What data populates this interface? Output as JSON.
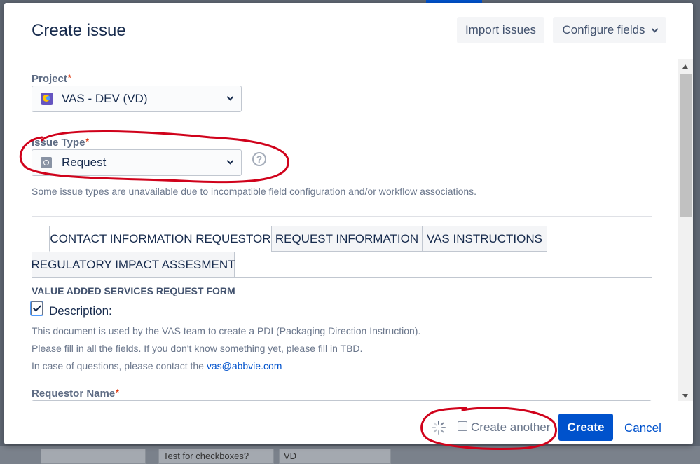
{
  "background": {
    "cells": [
      "",
      "Test for checkboxes?",
      "VD"
    ]
  },
  "dialog": {
    "title": "Create issue",
    "import_label": "Import issues",
    "configure_label": "Configure fields"
  },
  "form": {
    "project": {
      "label": "Project",
      "required_mark": "*",
      "value": "VAS - DEV (VD)"
    },
    "issue_type": {
      "label": "Issue Type",
      "required_mark": "*",
      "value": "Request",
      "help_glyph": "?"
    },
    "issue_type_note": "Some issue types are unavailable due to incompatible field configuration and/or workflow associations.",
    "tabs": [
      {
        "label": "CONTACT INFORMATION REQUESTOR",
        "active": true
      },
      {
        "label": "REQUEST INFORMATION",
        "active": false
      },
      {
        "label": "VAS INSTRUCTIONS",
        "active": false
      },
      {
        "label": "REGULATORY IMPACT ASSESMENT",
        "active": false
      }
    ],
    "section_title": "VALUE ADDED SERVICES REQUEST FORM",
    "description": {
      "checked": true,
      "label": "Description:"
    },
    "paragraphs": [
      "This document is used by the VAS team to create a PDI (Packaging Direction Instruction).",
      "Please fill in all the fields. If you don't know something yet, please fill in TBD."
    ],
    "contact_prefix": "In case of questions, please contact the ",
    "contact_email": "vas@abbvie.com",
    "requestor_name": {
      "label": "Requestor Name",
      "required_mark": "*"
    }
  },
  "footer": {
    "create_another_label": "Create another",
    "create_another_checked": false,
    "create_label": "Create",
    "cancel_label": "Cancel"
  },
  "colors": {
    "primary": "#0052cc",
    "required": "#de350b",
    "annotation": "#d0021b"
  },
  "icons": [
    "project-avatar-icon",
    "request-type-icon",
    "help-icon",
    "chevron-down-icon",
    "checkmark-icon",
    "loading-spinner-icon"
  ]
}
